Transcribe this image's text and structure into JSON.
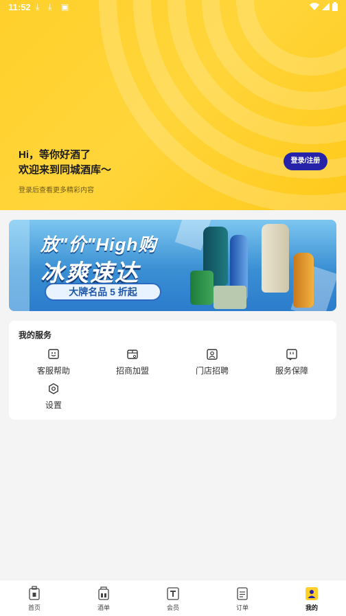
{
  "status": {
    "time": "11:52"
  },
  "header": {
    "greeting_line1": "Hi，等你好酒了",
    "greeting_line2": "欢迎来到同城酒库～",
    "subtitle": "登录后查看更多精彩内容",
    "login_button": "登录/注册"
  },
  "banner": {
    "headline": "放\"价\"High购",
    "subheadline": "冰爽速达",
    "promo": "大牌名品 5 折起"
  },
  "services": {
    "title": "我的服务",
    "items": [
      {
        "label": "客服帮助",
        "icon": "customer-service-icon"
      },
      {
        "label": "招商加盟",
        "icon": "franchise-icon"
      },
      {
        "label": "门店招聘",
        "icon": "recruit-icon"
      },
      {
        "label": "服务保障",
        "icon": "guarantee-icon"
      },
      {
        "label": "设置",
        "icon": "settings-icon"
      }
    ]
  },
  "tabbar": {
    "items": [
      {
        "label": "首页",
        "icon": "home-bottle-icon"
      },
      {
        "label": "酒单",
        "icon": "wine-list-icon"
      },
      {
        "label": "会员",
        "icon": "member-icon"
      },
      {
        "label": "订单",
        "icon": "order-icon"
      },
      {
        "label": "我的",
        "icon": "profile-icon",
        "active": true
      }
    ]
  },
  "colors": {
    "brand_yellow": "#ffd02b",
    "accent_blue": "#2623a8"
  }
}
